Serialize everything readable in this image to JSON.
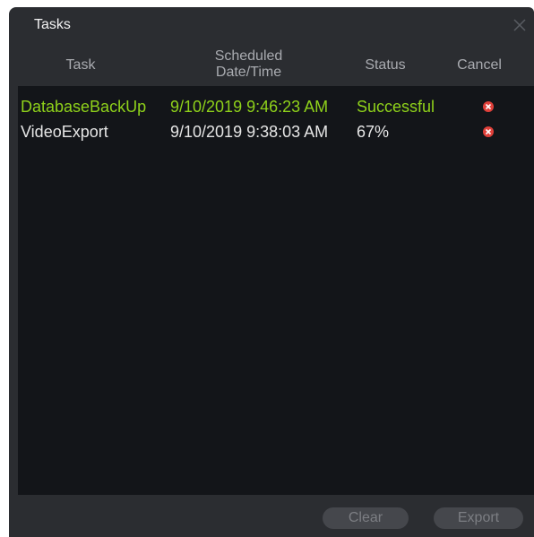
{
  "window": {
    "title": "Tasks"
  },
  "columns": {
    "task": "Task",
    "scheduled_line1": "Scheduled",
    "scheduled_line2": "Date/Time",
    "status": "Status",
    "cancel": "Cancel"
  },
  "rows": [
    {
      "task": "DatabaseBackUp",
      "scheduled": "9/10/2019 9:46:23 AM",
      "status": "Successful",
      "state": "success"
    },
    {
      "task": "VideoExport",
      "scheduled": "9/10/2019 9:38:03 AM",
      "status": "67%",
      "state": "running"
    }
  ],
  "buttons": {
    "clear": "Clear",
    "export": "Export"
  },
  "colors": {
    "dialog_bg": "#2b2d31",
    "list_bg": "#131519",
    "success_text": "#8fd21a",
    "normal_text": "#e6e6e6",
    "header_text": "#a9abb0",
    "cancel_icon": "#e0403a"
  },
  "icons": {
    "close": "close-icon",
    "cancel": "cancel-x-circle-icon"
  }
}
